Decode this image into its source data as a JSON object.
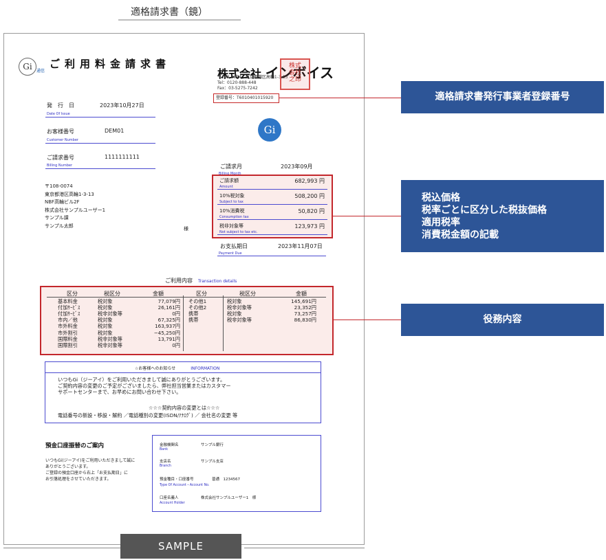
{
  "caption": "適格請求書（鏡）",
  "invoice": {
    "logo_text": "Gi",
    "logo_sub": "通信",
    "title": "ご利用料金請求書",
    "company": {
      "name_prefix": "株式会社",
      "name_main": "インボイス",
      "address": "〒108-0074　東京都港区高輪1-3-13",
      "tel": "Tel：0120-888-448",
      "fax": "Fax：03-5275-7242",
      "registration": "登録番号：T6010401015920",
      "seal_text": "株式会社インボイス之印"
    },
    "brand_mark": "Gi",
    "fields": [
      {
        "label": "発　行　日",
        "value": "2023年10月27日",
        "sub": "Date Of Issue"
      },
      {
        "label": "お客様番号",
        "value": "DEM01",
        "sub": "Customer Number"
      },
      {
        "label": "ご請求番号",
        "value": "1111111111",
        "sub": "Billing Number"
      }
    ],
    "address_lines": [
      "〒108-0074",
      "東京都港区高輪1-3-13",
      "NBF高輪ビル2F",
      "株式会社サンプルユーザー1",
      "サンプル課",
      "サンプル太郎"
    ],
    "honorific": "様",
    "billing_month": {
      "label": "ご請求月",
      "value": "2023年09月",
      "sub": "Billing Month"
    },
    "summary": [
      {
        "label": "ご請求額",
        "value": "682,993 円",
        "sub": "Amount"
      },
      {
        "label": "10%税対象",
        "value": "508,200 円",
        "sub": "Subject to tax"
      },
      {
        "label": "10%消費税",
        "value": "50,820 円",
        "sub": "Consumption tax"
      },
      {
        "label": "税非対象等",
        "value": "123,973 円",
        "sub": "Not subject to tax etc."
      }
    ],
    "payment_due": {
      "label": "お支払期日",
      "value": "2023年11月07日",
      "sub": "Payment Due"
    },
    "detail": {
      "heading": "ご利用内容",
      "heading_en": "Transaction details",
      "headers": [
        "区分",
        "税区分",
        "金額",
        "区分",
        "税区分",
        "金額"
      ],
      "left_rows": [
        [
          "基本料金",
          "税対象",
          "77,079円"
        ],
        [
          "付加ｻｰﾋﾞｽ",
          "税対象",
          "26,161円"
        ],
        [
          "付加ｻｰﾋﾞｽ",
          "税非対象等",
          "0円"
        ],
        [
          "市内／他",
          "税対象",
          "67,325円"
        ],
        [
          "市外料金",
          "税対象",
          "163,937円"
        ],
        [
          "市外割引",
          "税対象",
          "−45,250円"
        ],
        [
          "国際料金",
          "税非対象等",
          "13,791円"
        ],
        [
          "国際割引",
          "税非対象等",
          "0円"
        ]
      ],
      "right_rows": [
        [
          "その他1",
          "税対象",
          "145,691円"
        ],
        [
          "その他2",
          "税非対象等",
          "23,352円"
        ],
        [
          "携帯",
          "税対象",
          "73,257円"
        ],
        [
          "携帯",
          "税非対象等",
          "86,830円"
        ]
      ]
    },
    "notice": {
      "title": "☆お客様へのお知らせ",
      "title_en": "INFORMATION",
      "body": "いつもGi（ジーアイ）をご利用いただきまして誠にありがとうございます。\nご契約内容の変更のご予定がございましたら、弊社担当営業またはカスタマー\nサポートセンターまで、お早めにお問い合わせ下さい。",
      "subhead": "☆☆☆契約内容の変更とは☆☆☆",
      "items": "電話番号の新設・移設・解約 ／電話種別の変更(ISDN/ｱﾅﾛｸﾞ) ／ 会社名の変更 等"
    },
    "bank": {
      "title": "預金口座振替のご案内",
      "note": "いつもGi(ジーアイ)をご利用いただきまして誠に\nありがとうございます。\nご登録の預金口座から右上「お支払期日」に\nお引落処理をさせていただきます。",
      "rows": [
        {
          "label": "金融機関名",
          "value": "サンプル銀行",
          "sub": "Bank"
        },
        {
          "label": "支店名",
          "value": "サンプル支店",
          "sub": "Branch"
        },
        {
          "label": "預金種目・口座番号",
          "value": "普通　1234567",
          "sub": "Type Of Account・Account No."
        },
        {
          "label": "口座名義人",
          "value": "株式会社サンプルユーザー1　様",
          "sub": "Account Holder"
        }
      ]
    }
  },
  "callouts": {
    "registration": "適格請求書発行事業者登録番号",
    "tax_lines": [
      "税込価格",
      "税率ごとに区分した税抜価格",
      "適用税率",
      "消費税金額の記載"
    ],
    "services": "役務内容"
  },
  "sample_label": "SAMPLE",
  "colors": {
    "callout": "#2d5597",
    "highlight": "#c3262b",
    "link_blue": "#2b2bc2"
  }
}
